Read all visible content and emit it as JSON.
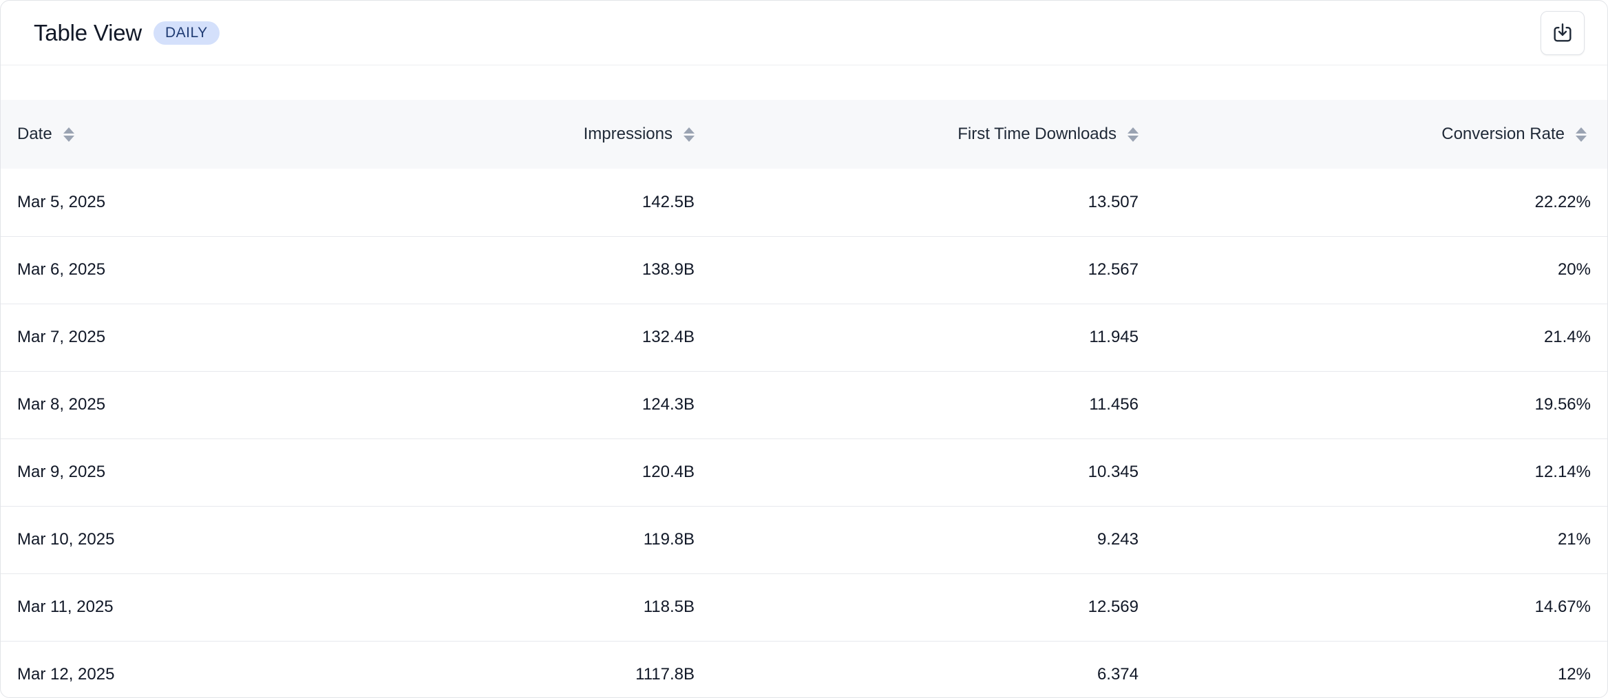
{
  "header": {
    "title": "Table View",
    "badge": "DAILY",
    "download_icon": "download-icon"
  },
  "table": {
    "columns": [
      "Date",
      "Impressions",
      "First Time Downloads",
      "Conversion Rate"
    ],
    "sort_icon": "sort-icon",
    "rows": [
      [
        "Mar 5, 2025",
        "142.5B",
        "13.507",
        "22.22%"
      ],
      [
        "Mar 6, 2025",
        "138.9B",
        "12.567",
        "20%"
      ],
      [
        "Mar 7, 2025",
        "132.4B",
        "11.945",
        "21.4%"
      ],
      [
        "Mar 8, 2025",
        "124.3B",
        "11.456",
        "19.56%"
      ],
      [
        "Mar 9, 2025",
        "120.4B",
        "10.345",
        "12.14%"
      ],
      [
        "Mar 10, 2025",
        "119.8B",
        "9.243",
        "21%"
      ],
      [
        "Mar 11, 2025",
        "118.5B",
        "12.569",
        "14.67%"
      ],
      [
        "Mar 12, 2025",
        "1117.8B",
        "6.374",
        "12%"
      ]
    ]
  },
  "colors": {
    "badge_bg": "#d4e0fb",
    "badge_text": "#1f3b73",
    "header_row_bg": "#f7f8fa",
    "border": "#e2e4e8",
    "sort_icon": "#9aa3b2"
  }
}
